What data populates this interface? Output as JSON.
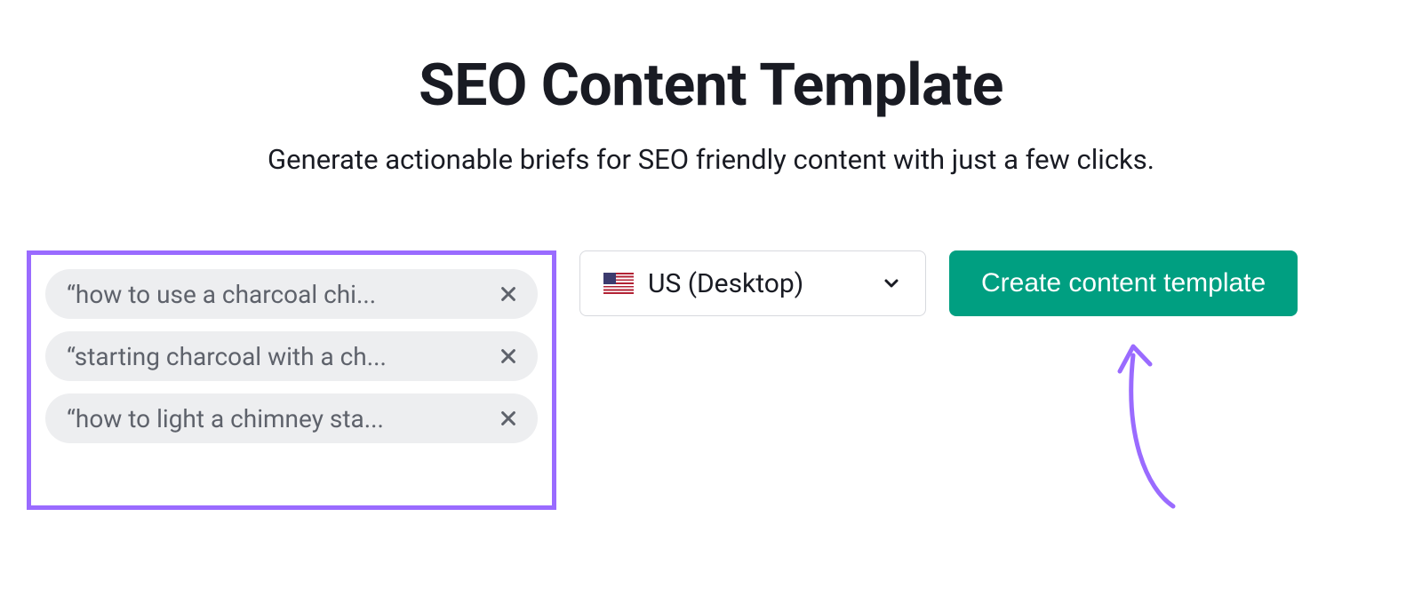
{
  "header": {
    "title": "SEO Content Template",
    "subtitle": "Generate actionable briefs for SEO friendly content with just a few clicks."
  },
  "keywords": {
    "items": [
      {
        "label": "“how to use a charcoal chi..."
      },
      {
        "label": "“starting charcoal with a ch..."
      },
      {
        "label": "“how to light a chimney sta..."
      }
    ]
  },
  "locale": {
    "flag": "us",
    "label": "US (Desktop)"
  },
  "actions": {
    "create_label": "Create content template"
  },
  "colors": {
    "highlight_border": "#9a6bff",
    "primary_button": "#009f81",
    "chip_bg": "#edeef0"
  }
}
